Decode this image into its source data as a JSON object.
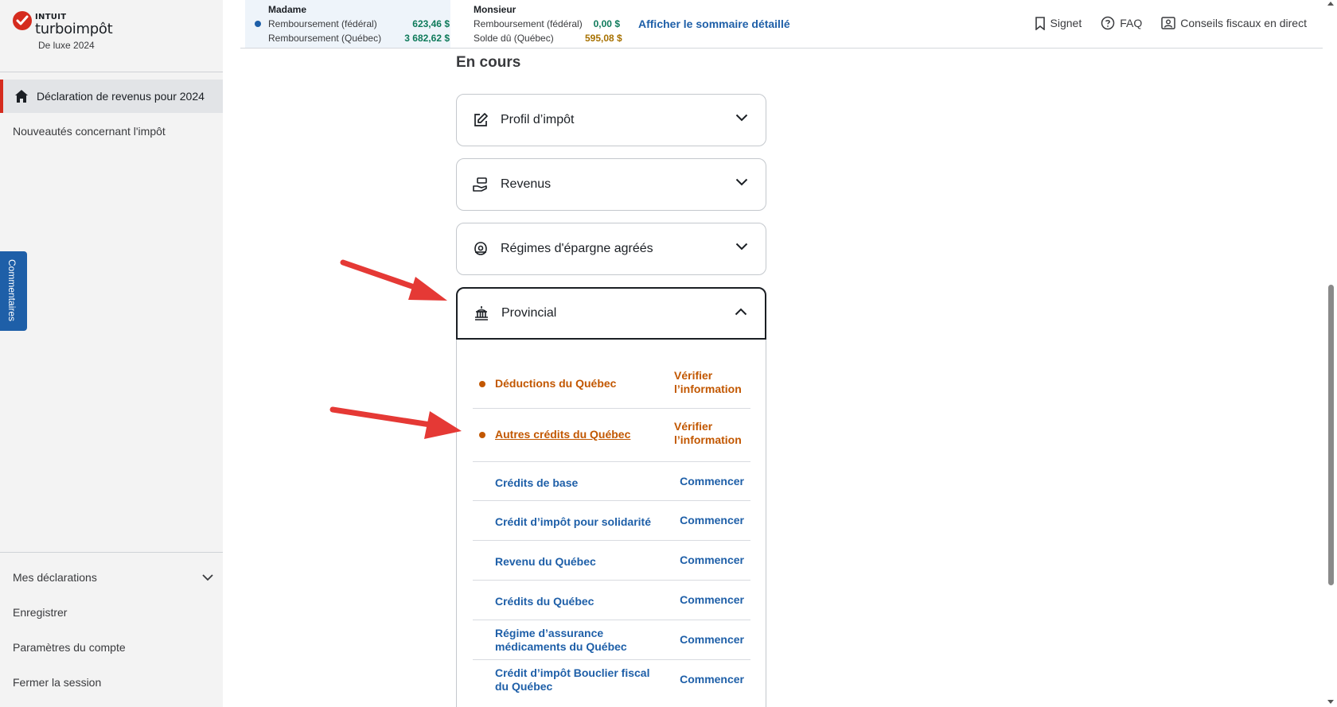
{
  "sidebar": {
    "logo": {
      "intuit": "INTUIT",
      "brand": "turboimpôt",
      "edition": "De luxe 2024"
    },
    "nav_active": "Déclaration de revenus pour 2024",
    "nav_news": "Nouveautés concernant l'impôt",
    "bottom": {
      "my_returns": "Mes déclarations",
      "save": "Enregistrer",
      "account_settings": "Paramètres du compte",
      "sign_out": "Fermer la session"
    },
    "feedback_tab": "Commentaires"
  },
  "summary": {
    "madame": {
      "name": "Madame",
      "rows": [
        {
          "label": "Remboursement (fédéral)",
          "value": "623,46  $"
        },
        {
          "label": "Remboursement (Québec)",
          "value": "3  682,62  $"
        }
      ]
    },
    "monsieur": {
      "name": "Monsieur",
      "rows": [
        {
          "label": "Remboursement (fédéral)",
          "value": "0,00  $"
        },
        {
          "label": "Solde dû (Québec)",
          "value": "595,08  $"
        }
      ]
    },
    "detail_link": "Afficher le sommaire détaillé"
  },
  "top_tools": {
    "bookmark": "Signet",
    "faq": "FAQ",
    "live_advice": "Conseils fiscaux en direct"
  },
  "main": {
    "section_title": "En cours",
    "accordions": [
      {
        "label": "Profil d’impôt"
      },
      {
        "label": "Revenus"
      },
      {
        "label": "Régimes d'épargne agréés"
      },
      {
        "label": "Provincial"
      }
    ],
    "provincial_items": [
      {
        "label": "Déductions du Québec",
        "action": "Vérifier l’information"
      },
      {
        "label": "Autres crédits du Québec",
        "action": "Vérifier l’information"
      },
      {
        "label": "Crédits de base",
        "action": "Commencer"
      },
      {
        "label": "Crédit d’impôt pour solidarité",
        "action": "Commencer"
      },
      {
        "label": "Revenu du Québec",
        "action": "Commencer"
      },
      {
        "label": "Crédits du Québec",
        "action": "Commencer"
      },
      {
        "label": "Régime d’assurance médicaments du Québec",
        "action": "Commencer"
      },
      {
        "label": "Crédit d’impôt Bouclier fiscal du Québec",
        "action": "Commencer"
      }
    ]
  },
  "colors": {
    "brand_red": "#d52b1e",
    "link_blue": "#1e5fa8",
    "warning_orange": "#c25700",
    "refund_green": "#0e7a5a",
    "due_gold": "#a77100",
    "annotation_arrow": "#e53935"
  }
}
